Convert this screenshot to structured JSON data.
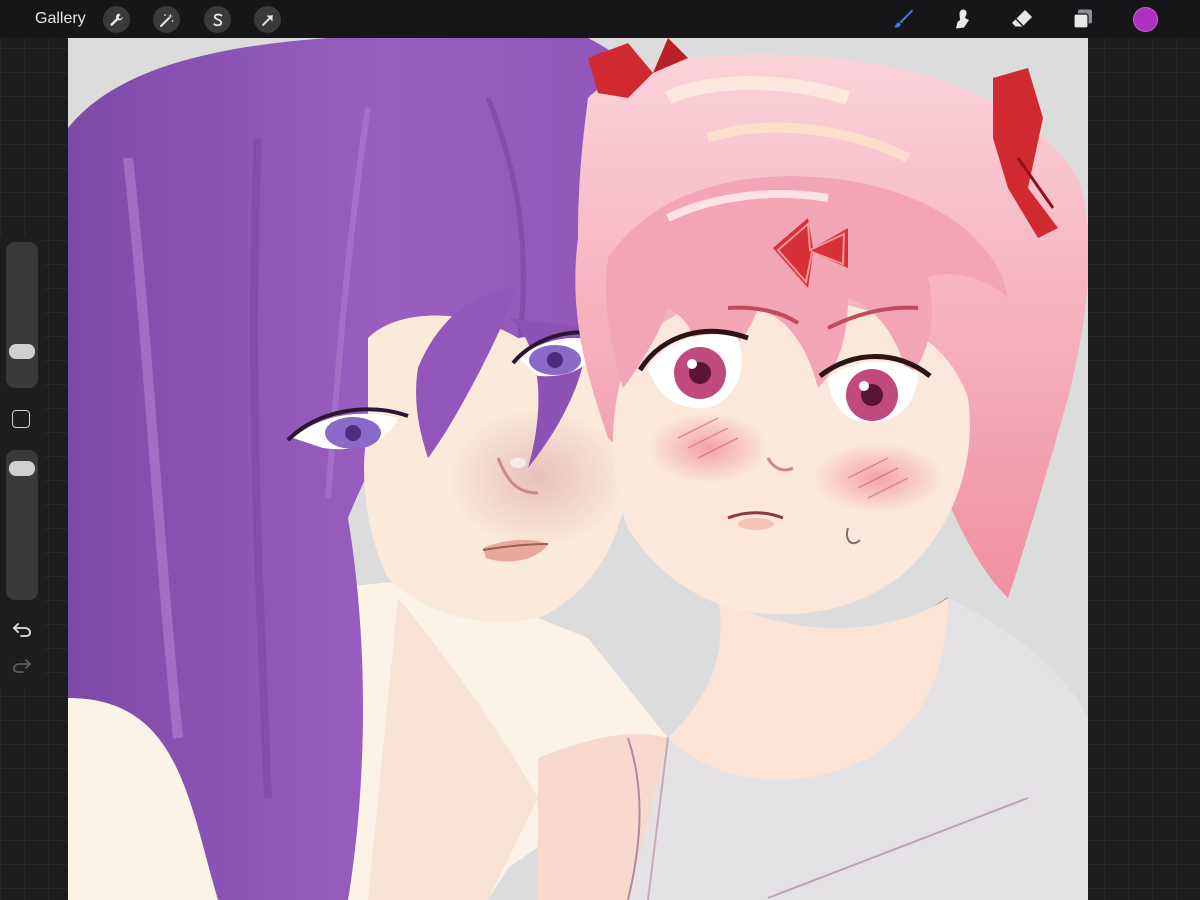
{
  "topbar": {
    "gallery_label": "Gallery",
    "left_tools": [
      {
        "icon": "wrench-icon"
      },
      {
        "icon": "magic-wand-icon"
      },
      {
        "icon": "selection-s-icon"
      },
      {
        "icon": "transform-arrow-icon"
      }
    ],
    "right_tools": [
      {
        "icon": "brush-icon",
        "active": true
      },
      {
        "icon": "smudge-icon"
      },
      {
        "icon": "eraser-icon"
      },
      {
        "icon": "layers-icon"
      }
    ],
    "current_color": "#b22fc4"
  },
  "colors": {
    "brush_active": "#3c7cf0",
    "toolbar_icon": "#e8e8e8",
    "hair_purple": "#9a5fc0",
    "hair_pink": "#f2a8b8",
    "skin": "#fbe9dc",
    "ribbon_red": "#d02a30"
  },
  "sidebar": {
    "brush_size": 0.22,
    "opacity": 0.92
  },
  "canvas": {
    "artwork": "illustration"
  }
}
